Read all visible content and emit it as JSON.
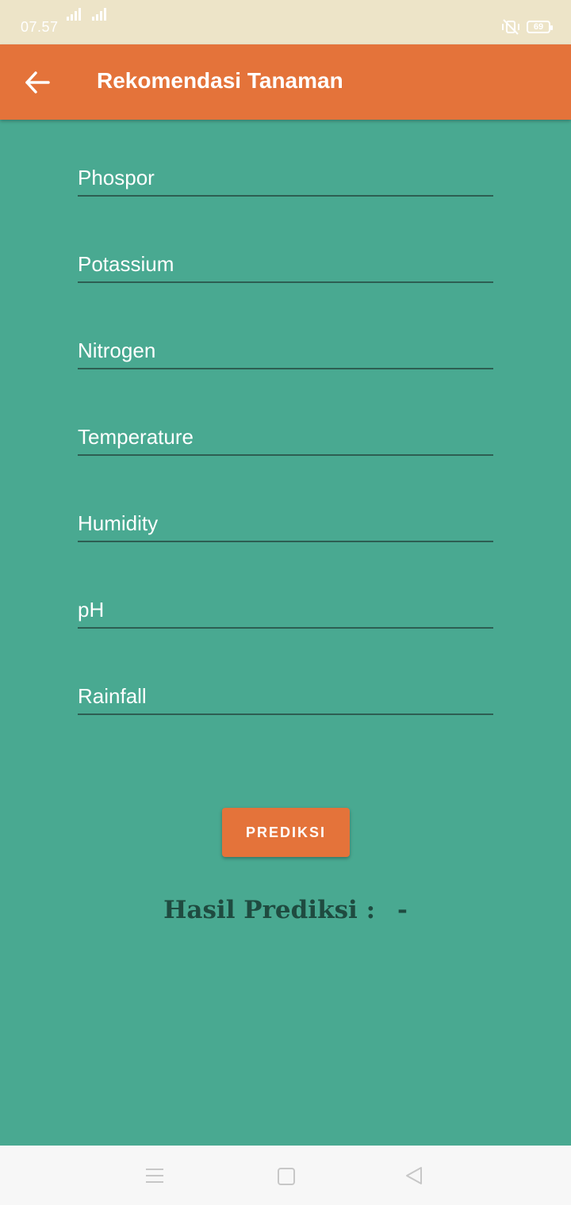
{
  "status_bar": {
    "time": "07.57",
    "battery": "69"
  },
  "app_bar": {
    "title": "Rekomendasi Tanaman"
  },
  "form": {
    "fields": [
      {
        "label": "Phospor"
      },
      {
        "label": "Potassium"
      },
      {
        "label": "Nitrogen"
      },
      {
        "label": "Temperature"
      },
      {
        "label": "Humidity"
      },
      {
        "label": "pH"
      },
      {
        "label": "Rainfall"
      }
    ],
    "predict_label": "PREDIKSI"
  },
  "result": {
    "label": "Hasil Prediksi :",
    "value": "-"
  },
  "colors": {
    "background": "#49A991",
    "accent": "#E4733A",
    "status_bar": "#EDE4C8"
  }
}
